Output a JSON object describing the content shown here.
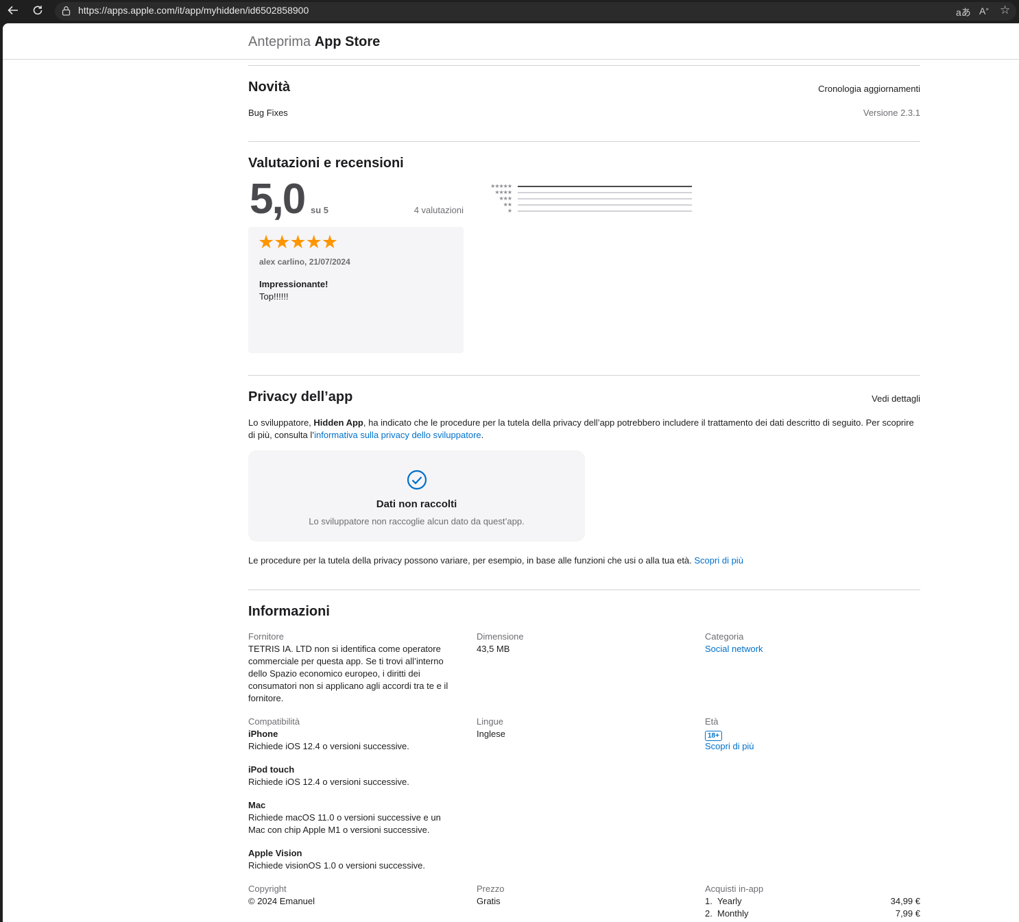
{
  "browser": {
    "url": "https://apps.apple.com/it/app/myhidden/id6502858900"
  },
  "header": {
    "brand_prefix": "Anteprima",
    "brand_name": "App Store"
  },
  "whats_new": {
    "title": "Novità",
    "history_link": "Cronologia aggiornamenti",
    "notes": "Bug Fixes",
    "version": "Versione 2.3.1"
  },
  "ratings": {
    "title": "Valutazioni e recensioni",
    "score": "5,0",
    "out_of": "su 5",
    "count": "4 valutazioni",
    "distribution": [
      {
        "stars": "★★★★★",
        "fraction": 1.0
      },
      {
        "stars": "★★★★",
        "fraction": 0.0
      },
      {
        "stars": "★★★",
        "fraction": 0.0
      },
      {
        "stars": "★★",
        "fraction": 0.0
      },
      {
        "stars": "★",
        "fraction": 0.0
      }
    ],
    "review": {
      "stars": "★★★★★",
      "author_date": "alex carlino, 21/07/2024",
      "title": "Impressionante!",
      "body": "Top!!!!!!"
    }
  },
  "privacy": {
    "title": "Privacy dell’app",
    "details_link": "Vedi dettagli",
    "intro_1": "Lo sviluppatore, ",
    "developer": "Hidden App",
    "intro_2": ", ha indicato che le procedure per la tutela della privacy dell’app potrebbero includere il trattamento dei dati descritto di seguito. Per scoprire di più, consulta l’",
    "policy_link": "informativa sulla privacy dello sviluppatore",
    "intro_3": ".",
    "card_title": "Dati non raccolti",
    "card_text": "Lo sviluppatore non raccoglie alcun dato da quest’app.",
    "footer_text": "Le procedure per la tutela della privacy possono variare, per esempio, in base alle funzioni che usi o alla tua età. ",
    "footer_link": "Scopri di più"
  },
  "info": {
    "title": "Informazioni",
    "provider_label": "Fornitore",
    "provider_value": "TETRIS IA. LTD non si identifica come operatore commerciale per questa app. Se ti trovi all’interno dello Spazio economico europeo, i diritti dei consumatori non si applicano agli accordi tra te e il fornitore.",
    "size_label": "Dimensione",
    "size_value": "43,5 MB",
    "category_label": "Categoria",
    "category_value": "Social network",
    "compat_label": "Compatibilità",
    "compat": [
      {
        "device": "iPhone",
        "req": "Richiede iOS 12.4 o versioni successive."
      },
      {
        "device": "iPod touch",
        "req": "Richiede iOS 12.4 o versioni successive."
      },
      {
        "device": "Mac",
        "req": "Richiede macOS 11.0 o versioni successive e un Mac con chip Apple M1 o versioni successive."
      },
      {
        "device": "Apple Vision",
        "req": "Richiede visionOS 1.0 o versioni successive."
      }
    ],
    "languages_label": "Lingue",
    "languages_value": "Inglese",
    "age_label": "Età",
    "age_badge": "18+",
    "age_link": "Scopri di più",
    "copyright_label": "Copyright",
    "copyright_value": "© 2024 Emanuel",
    "price_label": "Prezzo",
    "price_value": "Gratis",
    "iap_label": "Acquisti in-app",
    "iap": [
      {
        "num": "1.",
        "name": "Yearly",
        "price": "34,99 €"
      },
      {
        "num": "2.",
        "name": "Monthly",
        "price": "7,99 €"
      }
    ]
  },
  "colors": {
    "link": "#0070c9",
    "star": "#ff9500"
  }
}
